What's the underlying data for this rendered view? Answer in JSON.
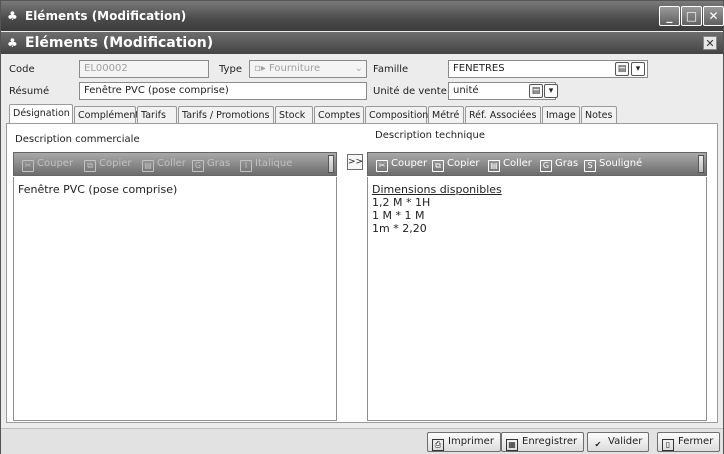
{
  "window": {
    "title": "Eléments (Modification)",
    "subtitle": "Eléments (Modification)",
    "buttons": {
      "minimize": "_",
      "maximize": "□",
      "close": "✕"
    }
  },
  "form": {
    "code_label": "Code",
    "code_value": "EL00002",
    "type_label": "Type",
    "type_value": "Fourniture",
    "famille_label": "Famille",
    "famille_value": "FENETRES",
    "resume_label": "Résumé",
    "resume_value": "Fenêtre PVC (pose comprise)",
    "unite_label": "Unité de vente",
    "unite_value": "unité"
  },
  "tabs": [
    {
      "label": "Désignation"
    },
    {
      "label": "Complément"
    },
    {
      "label": "Tarifs"
    },
    {
      "label": "Tarifs / Promotions"
    },
    {
      "label": "Stock"
    },
    {
      "label": "Comptes"
    },
    {
      "label": "Composition"
    },
    {
      "label": "Métré"
    },
    {
      "label": "Réf. Associées"
    },
    {
      "label": "Image"
    },
    {
      "label": "Notes"
    }
  ],
  "left_panel": {
    "title": "Description commerciale",
    "toolbar": {
      "cut": "Couper",
      "copy": "Copier",
      "paste": "Coller",
      "bold": "Gras",
      "italic": "Italique"
    },
    "lines": [
      "Fenêtre PVC (pose comprise)"
    ]
  },
  "transfer_button": ">>",
  "right_panel": {
    "title": "Description technique",
    "toolbar": {
      "cut": "Couper",
      "copy": "Copier",
      "paste": "Coller",
      "bold": "Gras",
      "underline": "Souligné"
    },
    "lines": [
      "Dimensions disponibles",
      "1,2 M * 1H",
      "1 M * 1 M",
      "1m * 2,20"
    ]
  },
  "footer": {
    "print": "Imprimer",
    "save": "Enregistrer",
    "validate": "Valider",
    "close": "Fermer"
  }
}
